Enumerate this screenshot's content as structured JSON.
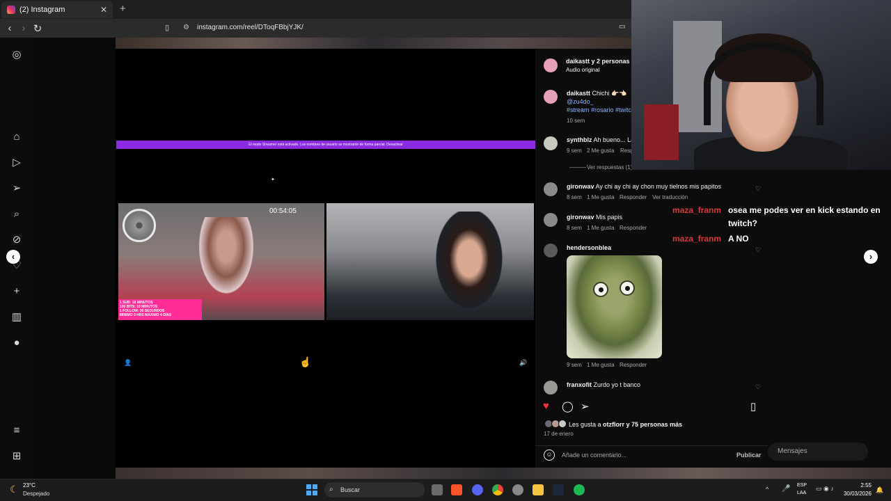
{
  "browser": {
    "tab_title": "(2) Instagram",
    "new_tab": "+",
    "url": "instagram.com/reel/DToqFBbjYJK/"
  },
  "video": {
    "timer": "00:54:05",
    "banner_text": "El modo Streamer está activado. Los nombres de usuario se mostrarán de forma parcial.  Desactivar",
    "pink_box_lines": [
      "1 SUB: 18 MINUTOS",
      "100 BITS: 10 MINUTOS",
      "1 FOLLOW: 30 SEGUNDOS",
      "MINIMO 3 HRS MÁXIMO 4 DÍAS"
    ]
  },
  "post": {
    "author": "daikastt y 2 personas más",
    "audio": "Audio original",
    "caption_user": "daikastt",
    "caption_text": "Chichi 👉🏻👈🏻",
    "caption_mention": "@zu4do_",
    "caption_tags": "#stream #rosario #twitch",
    "caption_time": "10 sem"
  },
  "comments": [
    {
      "user": "synthblz",
      "text": "Ah bueno... La",
      "time": "9 sem",
      "likes": "2 Me gusta",
      "reply": "Responder",
      "replies_toggle": "Ver respuestas (1)"
    },
    {
      "user": "gironwav",
      "text": "Ay chi ay chi ay chon muy tielnos mis papitos",
      "time": "8 sem",
      "likes": "1 Me gusta",
      "reply": "Responder",
      "translate": "Ver traducción"
    },
    {
      "user": "gironwav",
      "text": "Mis papis",
      "time": "8 sem",
      "likes": "1 Me gusta",
      "reply": "Responder"
    },
    {
      "user": "hendersonblea",
      "text": "",
      "time": "9 sem",
      "likes": "1 Me gusta",
      "reply": "Responder"
    },
    {
      "user": "franxofit",
      "text": "Zurdo yo t banco"
    }
  ],
  "footer": {
    "likes_text_prefix": "Les gusta a ",
    "likes_user": "otzflorr",
    "likes_text_suffix": " y 75 personas más",
    "date": "17 de enero",
    "comment_placeholder": "Añade un comentario...",
    "publish": "Publicar"
  },
  "chat_overlay": [
    {
      "user": "maza_franm",
      "message": "osea me podes ver en kick estando en"
    },
    {
      "user": "",
      "message": "twitch?"
    },
    {
      "user": "maza_franm",
      "message": "A NO"
    }
  ],
  "messages_widget": "Mensajes",
  "taskbar": {
    "temp": "23°C",
    "condition": "Despejado",
    "search": "Buscar",
    "lang_line1": "ESP",
    "lang_line2": "LAA",
    "time": "2:55",
    "date": "30/03/2026"
  },
  "colors": {
    "accent_purple": "#8a2be2",
    "like_red": "#ff3040",
    "chat_user_red": "#d63a3a"
  }
}
